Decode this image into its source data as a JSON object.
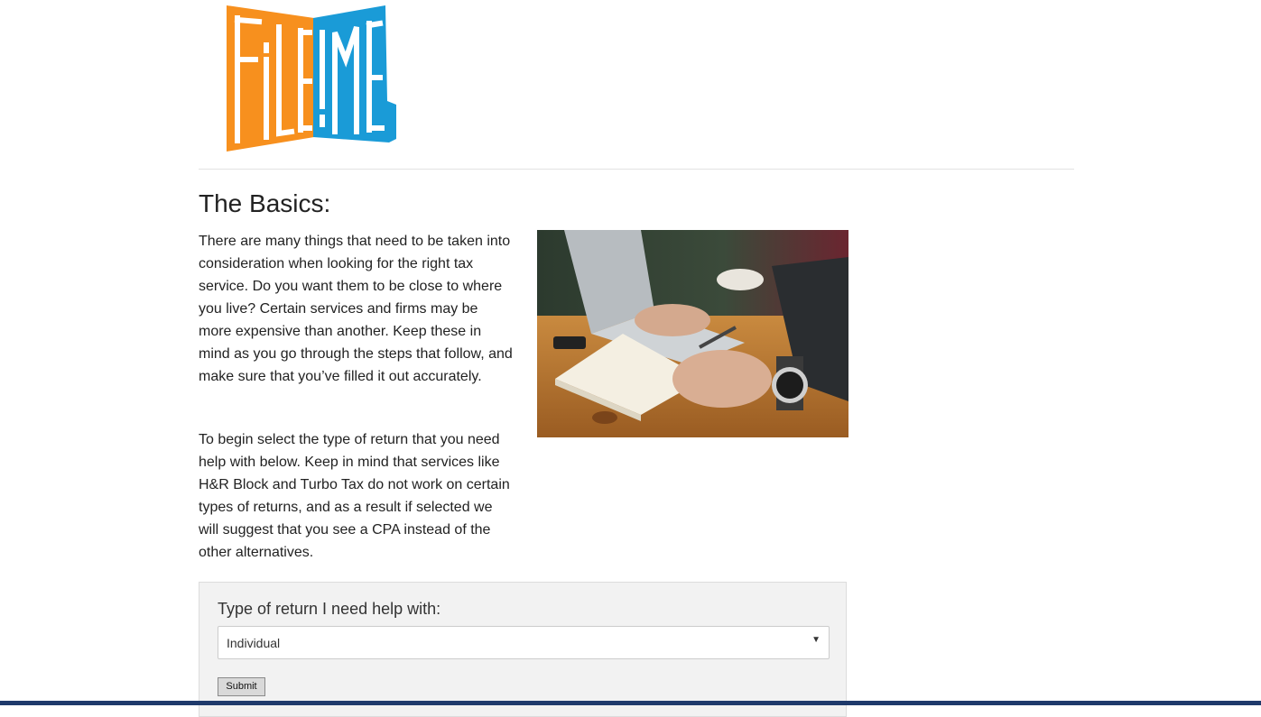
{
  "logo": {
    "alt_text": "FiLE!ME",
    "colors": {
      "orange": "#f7901e",
      "blue": "#1a9bd7"
    }
  },
  "section": {
    "heading": "The Basics:",
    "paragraph_1": "There are many things that need to be taken into consideration when looking for the right tax service. Do you want them to be close to where you live? Certain services and firms may be more expensive than another. Keep these in mind as you go through the steps that follow, and make sure that you’ve filled it out accurately.",
    "paragraph_2": "To begin select the type of return that you need help with below. Keep in mind that services like H&R Block and Turbo Tax do not work on certain types of returns, and as a result if selected we will suggest that you see a CPA instead of the other alternatives."
  },
  "form": {
    "label": "Type of return I need help with:",
    "select_value": "Individual",
    "submit_label": "Submit"
  },
  "colors": {
    "divider": "#e3e3e3",
    "panel_bg": "#f2f2f2",
    "bottom_strip": "#1f3a6b"
  }
}
